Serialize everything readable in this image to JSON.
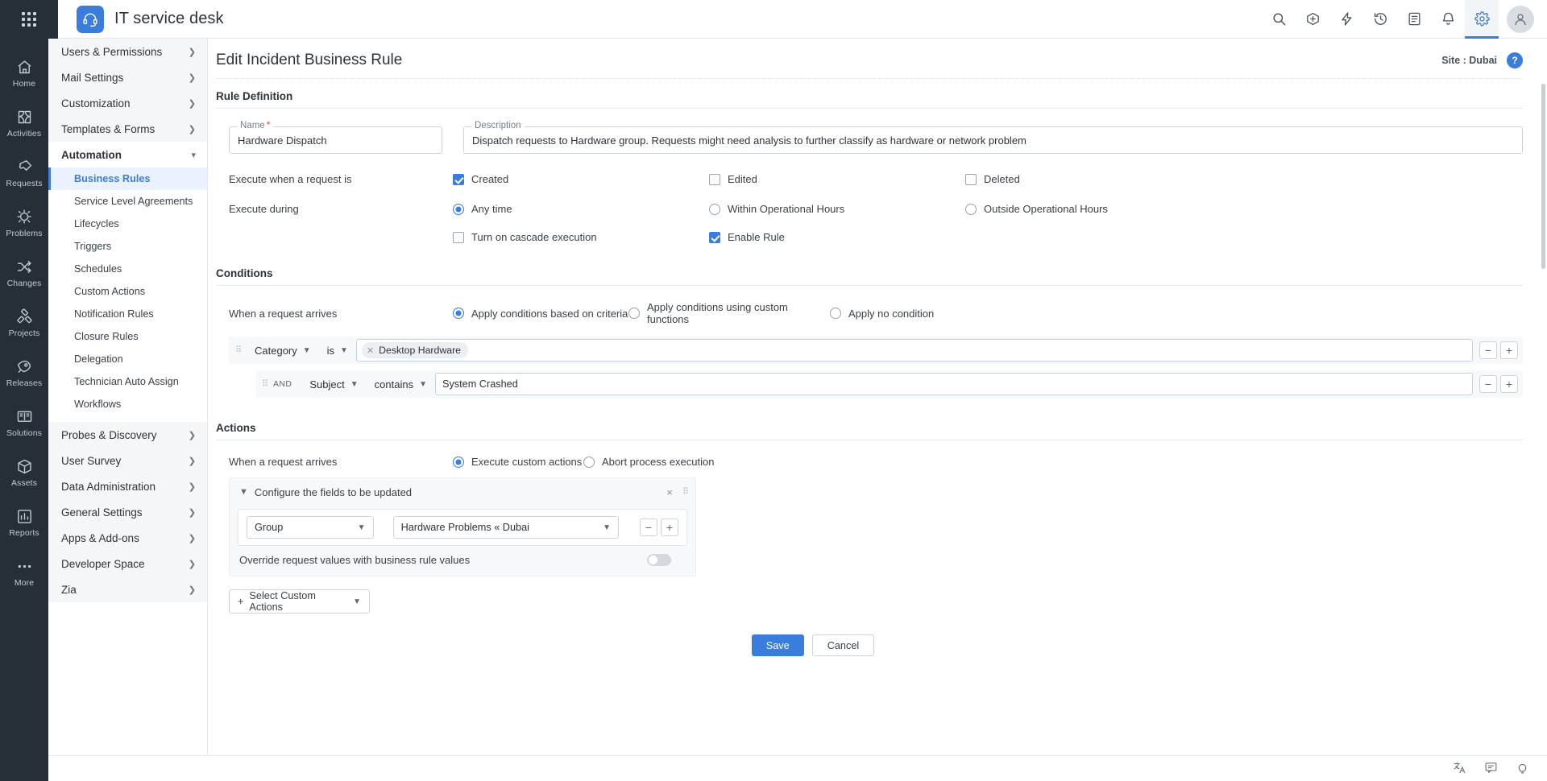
{
  "app": {
    "title": "IT service desk",
    "logo_icon": "headset-icon",
    "waffle_icon": "app-grid-icon"
  },
  "topbar": {
    "icons": [
      {
        "name": "search-icon",
        "label": "Search"
      },
      {
        "name": "add-icon",
        "label": "Add"
      },
      {
        "name": "quick-actions-icon",
        "label": "Quick Actions"
      },
      {
        "name": "history-icon",
        "label": "Recent Items"
      },
      {
        "name": "notes-icon",
        "label": "Notes"
      },
      {
        "name": "notifications-icon",
        "label": "Notifications"
      },
      {
        "name": "settings-icon",
        "label": "Settings"
      }
    ],
    "avatar_label": "User profile"
  },
  "rail": {
    "items": [
      {
        "label": "Home",
        "icon": "home-icon"
      },
      {
        "label": "Activities",
        "icon": "activities-icon"
      },
      {
        "label": "Requests",
        "icon": "requests-icon"
      },
      {
        "label": "Problems",
        "icon": "problems-icon"
      },
      {
        "label": "Changes",
        "icon": "changes-icon"
      },
      {
        "label": "Projects",
        "icon": "projects-icon"
      },
      {
        "label": "Releases",
        "icon": "releases-icon"
      },
      {
        "label": "Solutions",
        "icon": "solutions-icon"
      },
      {
        "label": "Assets",
        "icon": "assets-icon"
      },
      {
        "label": "Reports",
        "icon": "reports-icon"
      },
      {
        "label": "More",
        "icon": "more-icon"
      }
    ]
  },
  "subnav": {
    "groups": [
      {
        "label": "Users & Permissions",
        "expanded": false
      },
      {
        "label": "Mail Settings",
        "expanded": false
      },
      {
        "label": "Customization",
        "expanded": false
      },
      {
        "label": "Templates & Forms",
        "expanded": false
      },
      {
        "label": "Automation",
        "expanded": true
      }
    ],
    "automation_items": [
      {
        "label": "Business Rules",
        "selected": true
      },
      {
        "label": "Service Level Agreements",
        "selected": false
      },
      {
        "label": "Lifecycles",
        "selected": false
      },
      {
        "label": "Triggers",
        "selected": false
      },
      {
        "label": "Schedules",
        "selected": false
      },
      {
        "label": "Custom Actions",
        "selected": false
      },
      {
        "label": "Notification Rules",
        "selected": false
      },
      {
        "label": "Closure Rules",
        "selected": false
      },
      {
        "label": "Delegation",
        "selected": false
      },
      {
        "label": "Technician Auto Assign",
        "selected": false
      },
      {
        "label": "Workflows",
        "selected": false
      }
    ],
    "groups_after": [
      {
        "label": "Probes & Discovery"
      },
      {
        "label": "User Survey"
      },
      {
        "label": "Data Administration"
      },
      {
        "label": "General Settings"
      },
      {
        "label": "Apps & Add-ons"
      },
      {
        "label": "Developer Space"
      },
      {
        "label": "Zia"
      }
    ]
  },
  "page": {
    "title": "Edit Incident Business Rule",
    "site_label": "Site : Dubai",
    "help_label": "?"
  },
  "rule_definition": {
    "section_title": "Rule Definition",
    "name_label": "Name",
    "name_required": "*",
    "name_value": "Hardware Dispatch",
    "description_label": "Description",
    "description_value": "Dispatch requests to Hardware group. Requests might need analysis to further classify as hardware or network problem",
    "execute_when_label": "Execute when a request is",
    "execute_when_options": [
      {
        "label": "Created",
        "checked": true
      },
      {
        "label": "Edited",
        "checked": false
      },
      {
        "label": "Deleted",
        "checked": false
      }
    ],
    "execute_during_label": "Execute during",
    "execute_during_options": [
      {
        "label": "Any time",
        "selected": true
      },
      {
        "label": "Within Operational Hours",
        "selected": false
      },
      {
        "label": "Outside Operational Hours",
        "selected": false
      }
    ],
    "cascade_label": "Turn on cascade execution",
    "cascade_checked": false,
    "enable_rule_label": "Enable Rule",
    "enable_rule_checked": true
  },
  "conditions": {
    "section_title": "Conditions",
    "when_label": "When a request arrives",
    "mode_options": [
      {
        "label": "Apply conditions based on criteria",
        "selected": true
      },
      {
        "label": "Apply conditions using custom functions",
        "selected": false
      },
      {
        "label": "Apply no condition",
        "selected": false
      }
    ],
    "rows": [
      {
        "conjunction": "",
        "field": "Category",
        "operator": "is",
        "value_type": "tag",
        "value": "Desktop Hardware",
        "remove_label": "−",
        "add_label": "+"
      },
      {
        "conjunction": "AND",
        "field": "Subject",
        "operator": "contains",
        "value_type": "text",
        "value": "System Crashed",
        "remove_label": "−",
        "add_label": "+"
      }
    ]
  },
  "actions": {
    "section_title": "Actions",
    "when_label": "When a request arrives",
    "mode_options": [
      {
        "label": "Execute custom actions",
        "selected": true
      },
      {
        "label": "Abort process execution",
        "selected": false
      }
    ],
    "card": {
      "header": "Configure the fields to be updated",
      "close_label": "×",
      "drag_label": "drag",
      "field_select": "Group",
      "value_select": "Hardware Problems « Dubai",
      "remove_label": "−",
      "add_label": "+",
      "override_label": "Override request values with business rule values",
      "override_on": false
    },
    "select_custom_actions": "Select Custom Actions"
  },
  "footer": {
    "save_label": "Save",
    "cancel_label": "Cancel"
  },
  "statusbar": {
    "icons": [
      {
        "name": "translate-icon"
      },
      {
        "name": "feedback-icon"
      },
      {
        "name": "bulb-icon"
      }
    ]
  }
}
